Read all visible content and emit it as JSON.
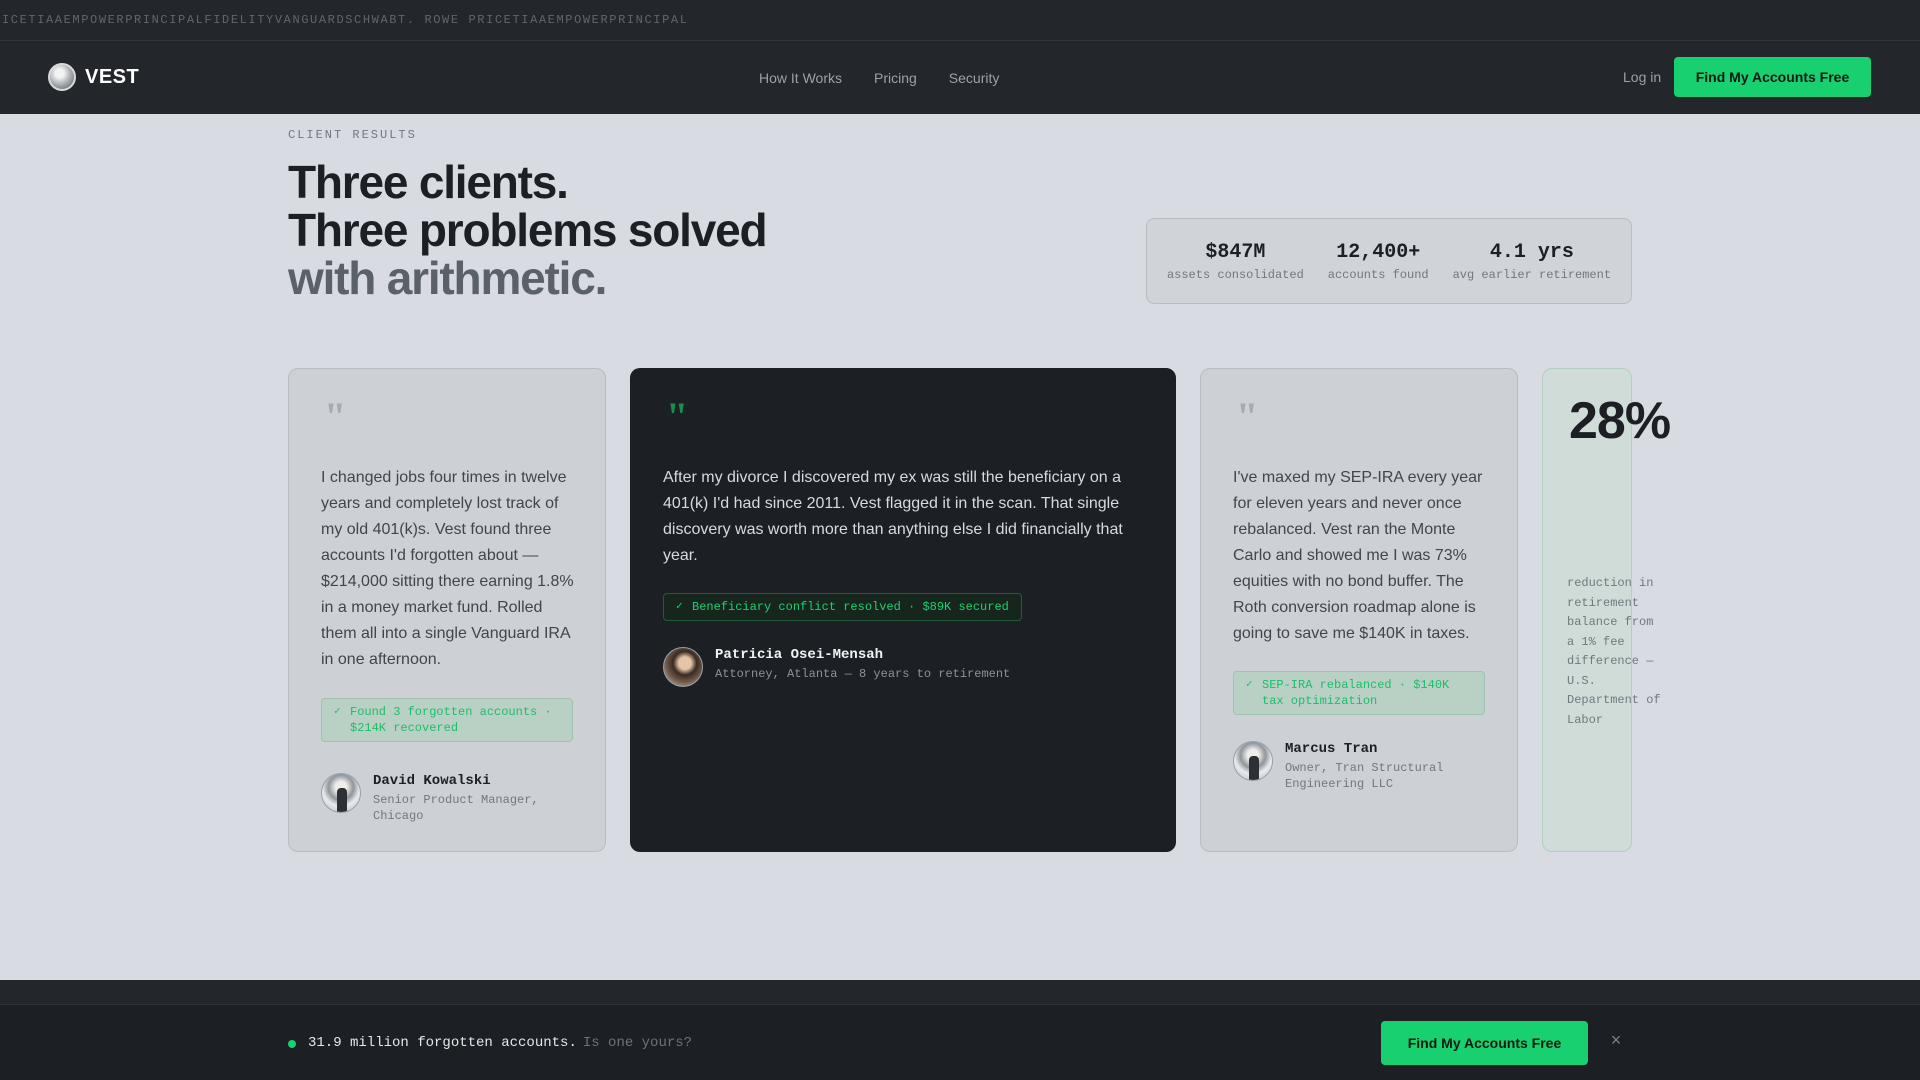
{
  "ticker": "ICETIAAEMPOWERPRINCIPALFIDELITYVANGUARDSCHWABT. ROWE PRICETIAAEMPOWERPRINCIPAL",
  "nav": {
    "logo": "VEST",
    "links": [
      "How It Works",
      "Pricing",
      "Security"
    ],
    "login": "Log in",
    "cta": "Find My Accounts Free"
  },
  "hero": {
    "eyebrow": "CLIENT RESULTS",
    "line1": "Three clients.",
    "line2": "Three problems solved",
    "line3": "with arithmetic."
  },
  "stats": [
    {
      "value": "$847M",
      "label": "assets consolidated"
    },
    {
      "value": "12,400+",
      "label": "accounts found"
    },
    {
      "value": "4.1 yrs",
      "label": "avg earlier retirement"
    }
  ],
  "testimonials": [
    {
      "quote": "I changed jobs four times in twelve years and completely lost track of my old 401(k)s. Vest found three accounts I'd forgotten about — $214,000 sitting there earning 1.8% in a money market fund. Rolled them all into a single Vanguard IRA in one afternoon.",
      "badge": "Found 3 forgotten accounts · $214K recovered",
      "name": "David Kowalski",
      "role": "Senior Product Manager, Chicago"
    },
    {
      "quote": "After my divorce I discovered my ex was still the beneficiary on a 401(k) I'd had since 2011. Vest flagged it in the scan. That single discovery was worth more than anything else I did financially that year.",
      "badge": "Beneficiary conflict resolved · $89K secured",
      "name": "Patricia Osei-Mensah",
      "role": "Attorney, Atlanta — 8 years to retirement"
    },
    {
      "quote": "I've maxed my SEP-IRA every year for eleven years and never once rebalanced. Vest ran the Monte Carlo and showed me I was 73% equities with no bond buffer. The Roth conversion roadmap alone is going to save me $140K in taxes.",
      "badge": "SEP-IRA rebalanced · $140K tax optimization",
      "name": "Marcus Tran",
      "role": "Owner, Tran Structural Engineering LLC"
    }
  ],
  "stat_card": {
    "number": "28%",
    "caption": "reduction in retirement balance from a 1% fee difference — U.S. Department of Labor"
  },
  "footer": {
    "message": "31.9 million forgotten accounts.",
    "muted": "Is one yours?",
    "cta": "Find My Accounts Free",
    "close": "×"
  },
  "colors": {
    "accent": "#18d06f",
    "dark": "#1c1f23",
    "page_bg": "#d8dbe1"
  }
}
